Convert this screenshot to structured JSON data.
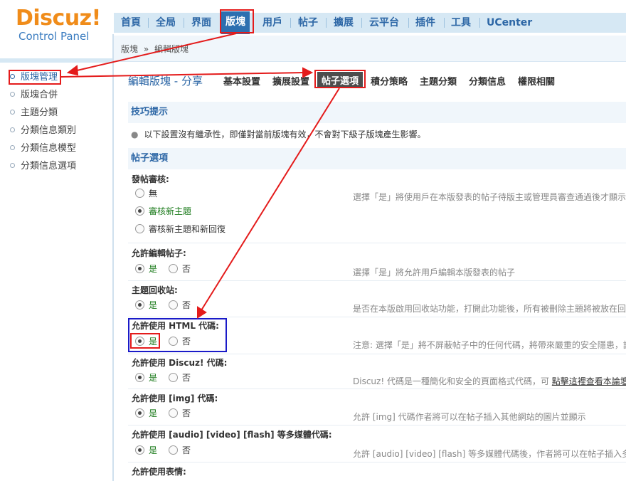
{
  "logo": {
    "brand": "Discuz!",
    "subtitle": "Control Panel"
  },
  "topnav": [
    {
      "label": "首頁",
      "active": false
    },
    {
      "label": "全局",
      "active": false
    },
    {
      "label": "界面",
      "active": false
    },
    {
      "label": "版塊",
      "active": true
    },
    {
      "label": "用戶",
      "active": false
    },
    {
      "label": "帖子",
      "active": false
    },
    {
      "label": "擴展",
      "active": false
    },
    {
      "label": "云平台",
      "active": false
    },
    {
      "label": "插件",
      "active": false
    },
    {
      "label": "工具",
      "active": false
    },
    {
      "label": "UCenter",
      "active": false
    }
  ],
  "breadcrumb": {
    "root": "版塊",
    "separator": "»",
    "current": "編輯版塊"
  },
  "sidebar": [
    {
      "label": "版塊管理",
      "active": true
    },
    {
      "label": "版塊合併",
      "active": false
    },
    {
      "label": "主題分類",
      "active": false
    },
    {
      "label": "分類信息類別",
      "active": false
    },
    {
      "label": "分類信息模型",
      "active": false
    },
    {
      "label": "分類信息選項",
      "active": false
    }
  ],
  "subnav": {
    "title": "編輯版塊 - 分享",
    "tabs": [
      {
        "label": "基本設置",
        "current": false
      },
      {
        "label": "擴展設置",
        "current": false
      },
      {
        "label": "帖子選項",
        "current": true
      },
      {
        "label": "積分策略",
        "current": false
      },
      {
        "label": "主題分類",
        "current": false
      },
      {
        "label": "分類信息",
        "current": false
      },
      {
        "label": "權限相關",
        "current": false
      }
    ]
  },
  "tips": {
    "heading": "技巧提示",
    "text": "以下設置沒有繼承性，即僅對當前版塊有效，不會對下級子版塊產生影響。"
  },
  "post_options": {
    "heading": "帖子選項",
    "audit": {
      "label": "發帖審核:",
      "options": [
        "無",
        "審核新主題",
        "審核新主題和新回復"
      ],
      "selected": "審核新主題",
      "desc": "選擇「是」將使用戶在本版發表的帖子待版主或管理員審查通過後才顯示"
    },
    "rows": [
      {
        "label": "允許編輯帖子:",
        "yes": "是",
        "no": "否",
        "selected": "是",
        "desc": "選擇「是」將允許用戶編輯本版發表的帖子"
      },
      {
        "label": "主題回收站:",
        "yes": "是",
        "no": "否",
        "selected": "是",
        "desc": "是否在本版啟用回收站功能，打開此功能後，所有被刪除主題將被放在回"
      },
      {
        "label": "允許使用 HTML 代碼:",
        "yes": "是",
        "no": "否",
        "selected": "是",
        "desc": "注意: 選擇「是」將不屏蔽帖子中的任何代碼，將帶來嚴重的安全隱患，請"
      },
      {
        "label": "允許使用 Discuz! 代碼:",
        "yes": "是",
        "no": "否",
        "selected": "是",
        "desc": "Discuz! 代碼是一種簡化和安全的頁面格式代碼，可",
        "link": "點擊這裡查看本論壇"
      },
      {
        "label": "允許使用 [img] 代碼:",
        "yes": "是",
        "no": "否",
        "selected": "是",
        "desc": "允許 [img] 代碼作者將可以在帖子插入其他網站的圖片並顯示"
      },
      {
        "label": "允許使用 [audio] [video] [flash] 等多媒體代碼:",
        "yes": "是",
        "no": "否",
        "selected": "是",
        "desc": "允許 [audio] [video] [flash] 等多媒體代碼後，作者將可以在帖子插入多"
      }
    ],
    "last_label": "允許使用表情:"
  },
  "colors": {
    "accent": "#2d67a6",
    "annotation_red": "#e41b1b",
    "annotation_blue": "#1a1ac8",
    "logo_orange": "#f08c1a"
  }
}
